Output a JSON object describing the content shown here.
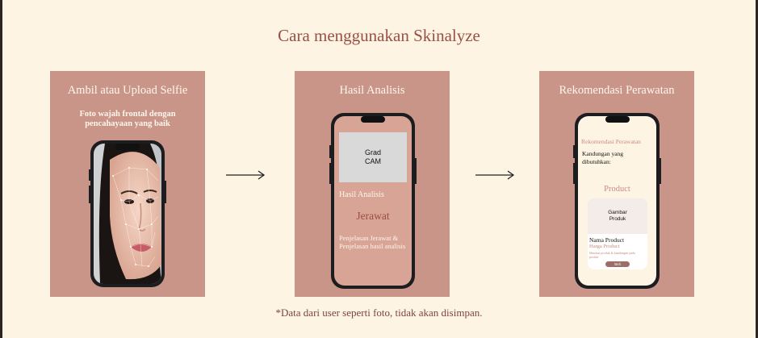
{
  "page": {
    "title": "Cara menggunakan Skinalyze",
    "footnote": "*Data dari user seperti foto, tidak akan disimpan."
  },
  "step1": {
    "title": "Ambil atau Upload Selfie",
    "subtitle": "Foto wajah frontal dengan pencahayaan yang baik"
  },
  "step2": {
    "title": "Hasil Analisis",
    "gradcam_label": "Grad\nCAM",
    "section_label": "Hasil Analisis",
    "result": "Jerawat",
    "description": "Penjelasan Jerawat & Penjelasan hasil analisis"
  },
  "step3": {
    "title": "Rekomendasi Perawatan",
    "screen_header": "Rekomendasi Perawatan",
    "ingredients": "Kandungan yang dibutuhkan:",
    "product_heading": "Product",
    "image_placeholder": "Gambar\nProduk",
    "product_name": "Nama Product",
    "product_price": "Harga Product",
    "product_note": "Manfaat produk & kandungan pada produk",
    "buy_button": "Beli"
  },
  "colors": {
    "background": "#fdf4e4",
    "card": "#c99589",
    "accent": "#9b4f44"
  },
  "icons": [
    "arrow-right-icon",
    "arrow-right-icon"
  ]
}
